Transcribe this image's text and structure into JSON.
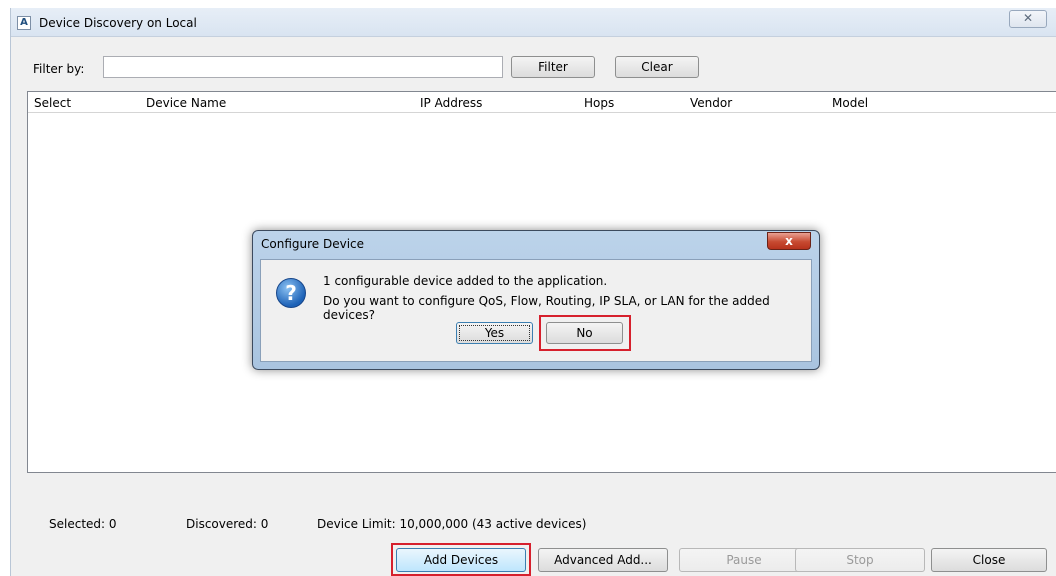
{
  "window": {
    "title": "Device Discovery on Local",
    "app_icon_glyph": "A",
    "close_glyph": "✕"
  },
  "filter": {
    "label": "Filter by:",
    "value": "",
    "filter_button": "Filter",
    "clear_button": "Clear"
  },
  "table": {
    "columns": [
      "Select",
      "Device Name",
      "IP Address",
      "Hops",
      "Vendor",
      "Model"
    ],
    "rows": []
  },
  "status": {
    "selected": "Selected: 0",
    "discovered": "Discovered: 0",
    "device_limit": "Device Limit: 10,000,000 (43 active devices)"
  },
  "actions": {
    "add_devices": "Add Devices",
    "advanced_add": "Advanced Add...",
    "pause": "Pause",
    "stop": "Stop",
    "close": "Close"
  },
  "dialog": {
    "title": "Configure Device",
    "close_glyph": "x",
    "icon": "question-icon",
    "icon_glyph": "?",
    "message_line1": "1 configurable device added to the application.",
    "message_line2": "Do you want to configure QoS, Flow, Routing, IP SLA, or LAN for the added devices?",
    "yes_button": "Yes",
    "no_button": "No"
  },
  "colors": {
    "highlight": "#d6202d",
    "dialog_frame": "#a9c4e0",
    "dialog_close": "#c74a31"
  }
}
